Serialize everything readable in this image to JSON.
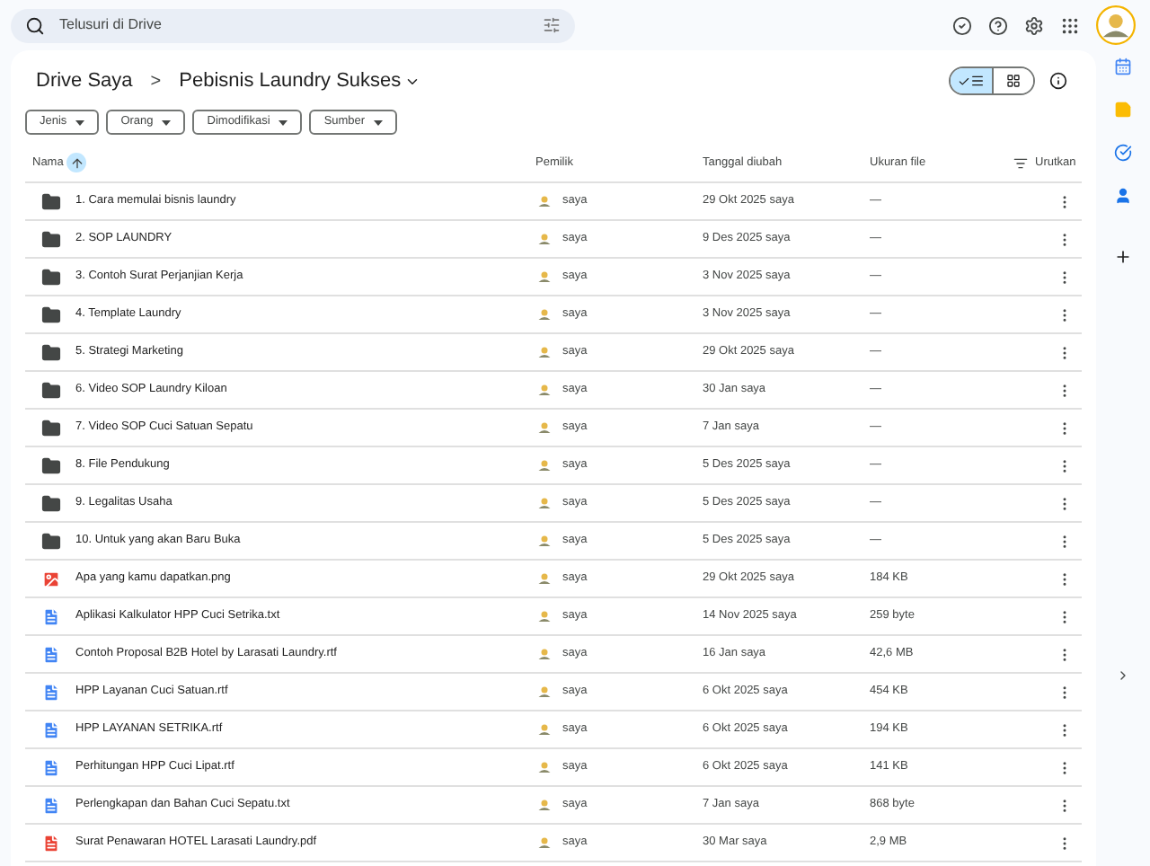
{
  "search": {
    "placeholder": "Telusuri di Drive"
  },
  "breadcrumb": {
    "root": "Drive Saya",
    "separator": ">",
    "current": "Pebisnis Laundry Sukses"
  },
  "view_toggle": [
    {
      "kind": "list",
      "selected": true
    },
    {
      "kind": "grid",
      "selected": false
    }
  ],
  "filters": [
    "Jenis",
    "Orang",
    "Dimodifikasi",
    "Sumber"
  ],
  "table": {
    "columns": [
      "Nama",
      "Pemilik",
      "Tanggal diubah",
      "Ukuran file"
    ],
    "sort_button": "Urutkan",
    "rows": [
      {
        "kind": "folder",
        "name": "1. Cara memulai bisnis laundry",
        "owner": "saya",
        "modified": "29 Okt 2025 saya",
        "size": "—"
      },
      {
        "kind": "folder",
        "name": "2. SOP LAUNDRY",
        "owner": "saya",
        "modified": "9 Des 2025 saya",
        "size": "—"
      },
      {
        "kind": "folder",
        "name": "3. Contoh Surat Perjanjian Kerja",
        "owner": "saya",
        "modified": "3 Nov 2025 saya",
        "size": "—"
      },
      {
        "kind": "folder",
        "name": "4. Template Laundry",
        "owner": "saya",
        "modified": "3 Nov 2025 saya",
        "size": "—"
      },
      {
        "kind": "folder",
        "name": "5. Strategi Marketing",
        "owner": "saya",
        "modified": "29 Okt 2025 saya",
        "size": "—"
      },
      {
        "kind": "folder",
        "name": "6. Video SOP Laundry Kiloan",
        "owner": "saya",
        "modified": "30 Jan saya",
        "size": "—"
      },
      {
        "kind": "folder",
        "name": "7. Video SOP Cuci Satuan Sepatu",
        "owner": "saya",
        "modified": "7 Jan saya",
        "size": "—"
      },
      {
        "kind": "folder",
        "name": "8. File Pendukung",
        "owner": "saya",
        "modified": "5 Des 2025 saya",
        "size": "—"
      },
      {
        "kind": "folder",
        "name": "9. Legalitas Usaha",
        "owner": "saya",
        "modified": "5 Des 2025 saya",
        "size": "—"
      },
      {
        "kind": "folder",
        "name": "10. Untuk yang akan Baru Buka",
        "owner": "saya",
        "modified": "5 Des 2025 saya",
        "size": "—"
      },
      {
        "kind": "image",
        "name": "Apa yang kamu dapatkan.png",
        "owner": "saya",
        "modified": "29 Okt 2025 saya",
        "size": "184 KB"
      },
      {
        "kind": "doc",
        "name": "Aplikasi Kalkulator HPP Cuci Setrika.txt",
        "owner": "saya",
        "modified": "14 Nov 2025 saya",
        "size": "259 byte"
      },
      {
        "kind": "doc",
        "name": "Contoh Proposal B2B Hotel by Larasati Laundry.rtf",
        "owner": "saya",
        "modified": "16 Jan saya",
        "size": "42,6 MB"
      },
      {
        "kind": "doc",
        "name": "HPP Layanan Cuci Satuan.rtf",
        "owner": "saya",
        "modified": "6 Okt 2025 saya",
        "size": "454 KB"
      },
      {
        "kind": "doc",
        "name": "HPP LAYANAN SETRIKA.rtf",
        "owner": "saya",
        "modified": "6 Okt 2025 saya",
        "size": "194 KB"
      },
      {
        "kind": "doc",
        "name": "Perhitungan HPP Cuci Lipat.rtf",
        "owner": "saya",
        "modified": "6 Okt 2025 saya",
        "size": "141 KB"
      },
      {
        "kind": "doc",
        "name": "Perlengkapan dan Bahan Cuci Sepatu.txt",
        "owner": "saya",
        "modified": "7 Jan saya",
        "size": "868 byte"
      },
      {
        "kind": "pdf",
        "name": "Surat Penawaran HOTEL Larasati Laundry.pdf",
        "owner": "saya",
        "modified": "30 Mar saya",
        "size": "2,9 MB"
      }
    ]
  }
}
